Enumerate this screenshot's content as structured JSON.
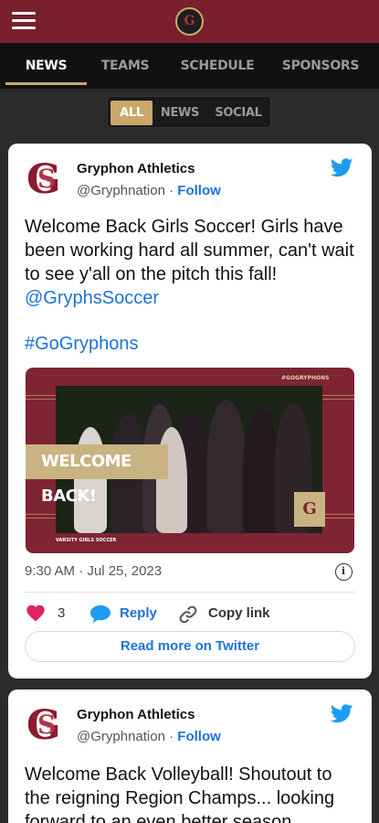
{
  "header": {
    "menu_icon": "hamburger-menu-icon",
    "logo": "gryphon-logo"
  },
  "logo_letter": "G",
  "tabs": [
    {
      "label": "NEWS",
      "active": true
    },
    {
      "label": "TEAMS",
      "active": false
    },
    {
      "label": "SCHEDULE",
      "active": false
    },
    {
      "label": "SPONSORS",
      "active": false
    }
  ],
  "filters": [
    {
      "label": "ALL",
      "active": true
    },
    {
      "label": "NEWS",
      "active": false
    },
    {
      "label": "SOCIAL",
      "active": false
    }
  ],
  "colors": {
    "brand_maroon": "#7a1f2e",
    "gold": "#c9a86a",
    "twitter_blue": "#1d9bf0",
    "link_blue": "#1d72d8",
    "like_pink": "#e0245e"
  },
  "posts": [
    {
      "author": "Gryphon Athletics",
      "handle": "@Gryphnation",
      "separator": "·",
      "follow": "Follow",
      "text": "Welcome Back Girls Soccer! Girls have been working hard all summer, can't wait to see y'all on the pitch this fall!",
      "mention": "@GryphsSoccer",
      "hashtag": "#GoGryphons",
      "media": {
        "tag": "#GOGRYPHONS",
        "banner": "WELCOME BACK!",
        "footer": "VARSITY GIRLS SOCCER"
      },
      "timestamp": "9:30 AM · Jul 25, 2023",
      "likes": "3",
      "reply": "Reply",
      "copy_link": "Copy link",
      "read_more": "Read more on Twitter"
    },
    {
      "author": "Gryphon Athletics",
      "handle": "@Gryphnation",
      "separator": "·",
      "follow": "Follow",
      "text": "Welcome Back Volleyball! Shoutout to the reigning Region Champs... looking forward to an even better season"
    }
  ]
}
